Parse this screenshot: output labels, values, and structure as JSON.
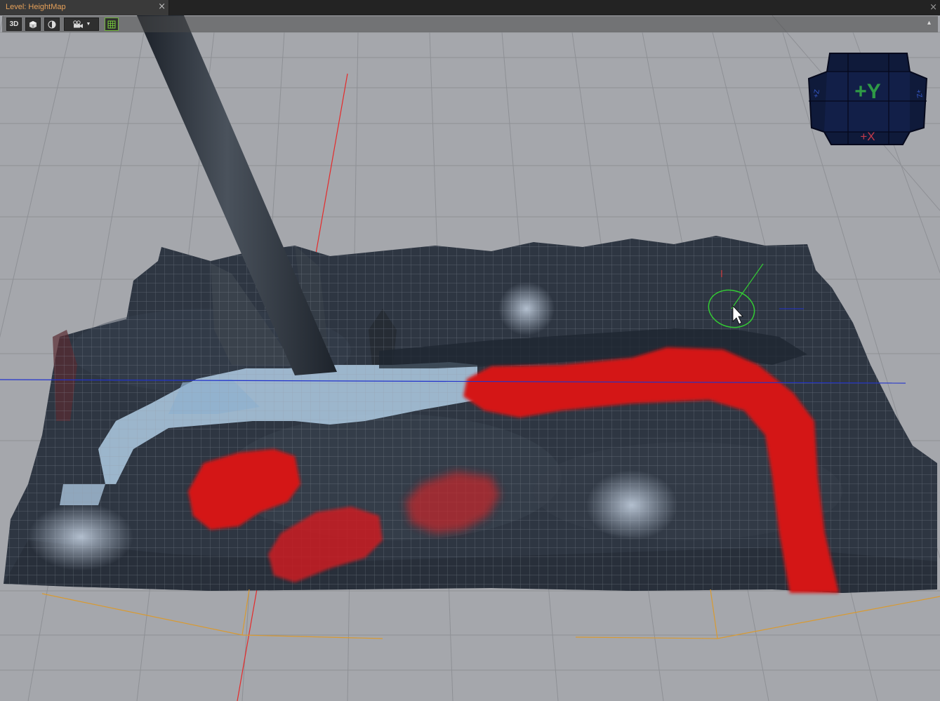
{
  "window": {
    "tab_title": "Level: HeightMap",
    "tab_close": "×",
    "window_close": "×"
  },
  "toolbar": {
    "view_mode_label": "3D",
    "buttons": [
      {
        "name": "3d-view-toggle",
        "icon": "text-3d"
      },
      {
        "name": "perspective-cube",
        "icon": "cube-icon"
      },
      {
        "name": "display-mode",
        "icon": "half-shaded-circle-icon"
      },
      {
        "name": "camera-dropdown",
        "icon": "camera-icon"
      },
      {
        "name": "grid-toggle",
        "icon": "grid-icon"
      }
    ],
    "collapse_glyph": "▴"
  },
  "gizmo": {
    "top_label": "+Y",
    "front_label": "+X",
    "left_label": "+Z",
    "right_label": "+Z",
    "colors": {
      "face": "#0f1a3a",
      "y_axis": "#2f9a46",
      "x_axis": "#c43a4b",
      "z_axis": "#3558c8"
    }
  },
  "colors": {
    "ground": "#a4a6ab",
    "grid_line": "#8d8f94",
    "paint_red": "#d51515",
    "water": "#a9c6de",
    "terrain": "#2c3440",
    "selection_ring": "#33cc33",
    "x_axis_line": "#e52a2a",
    "z_axis_line": "#2233cc",
    "bounds": "#d89a32"
  }
}
